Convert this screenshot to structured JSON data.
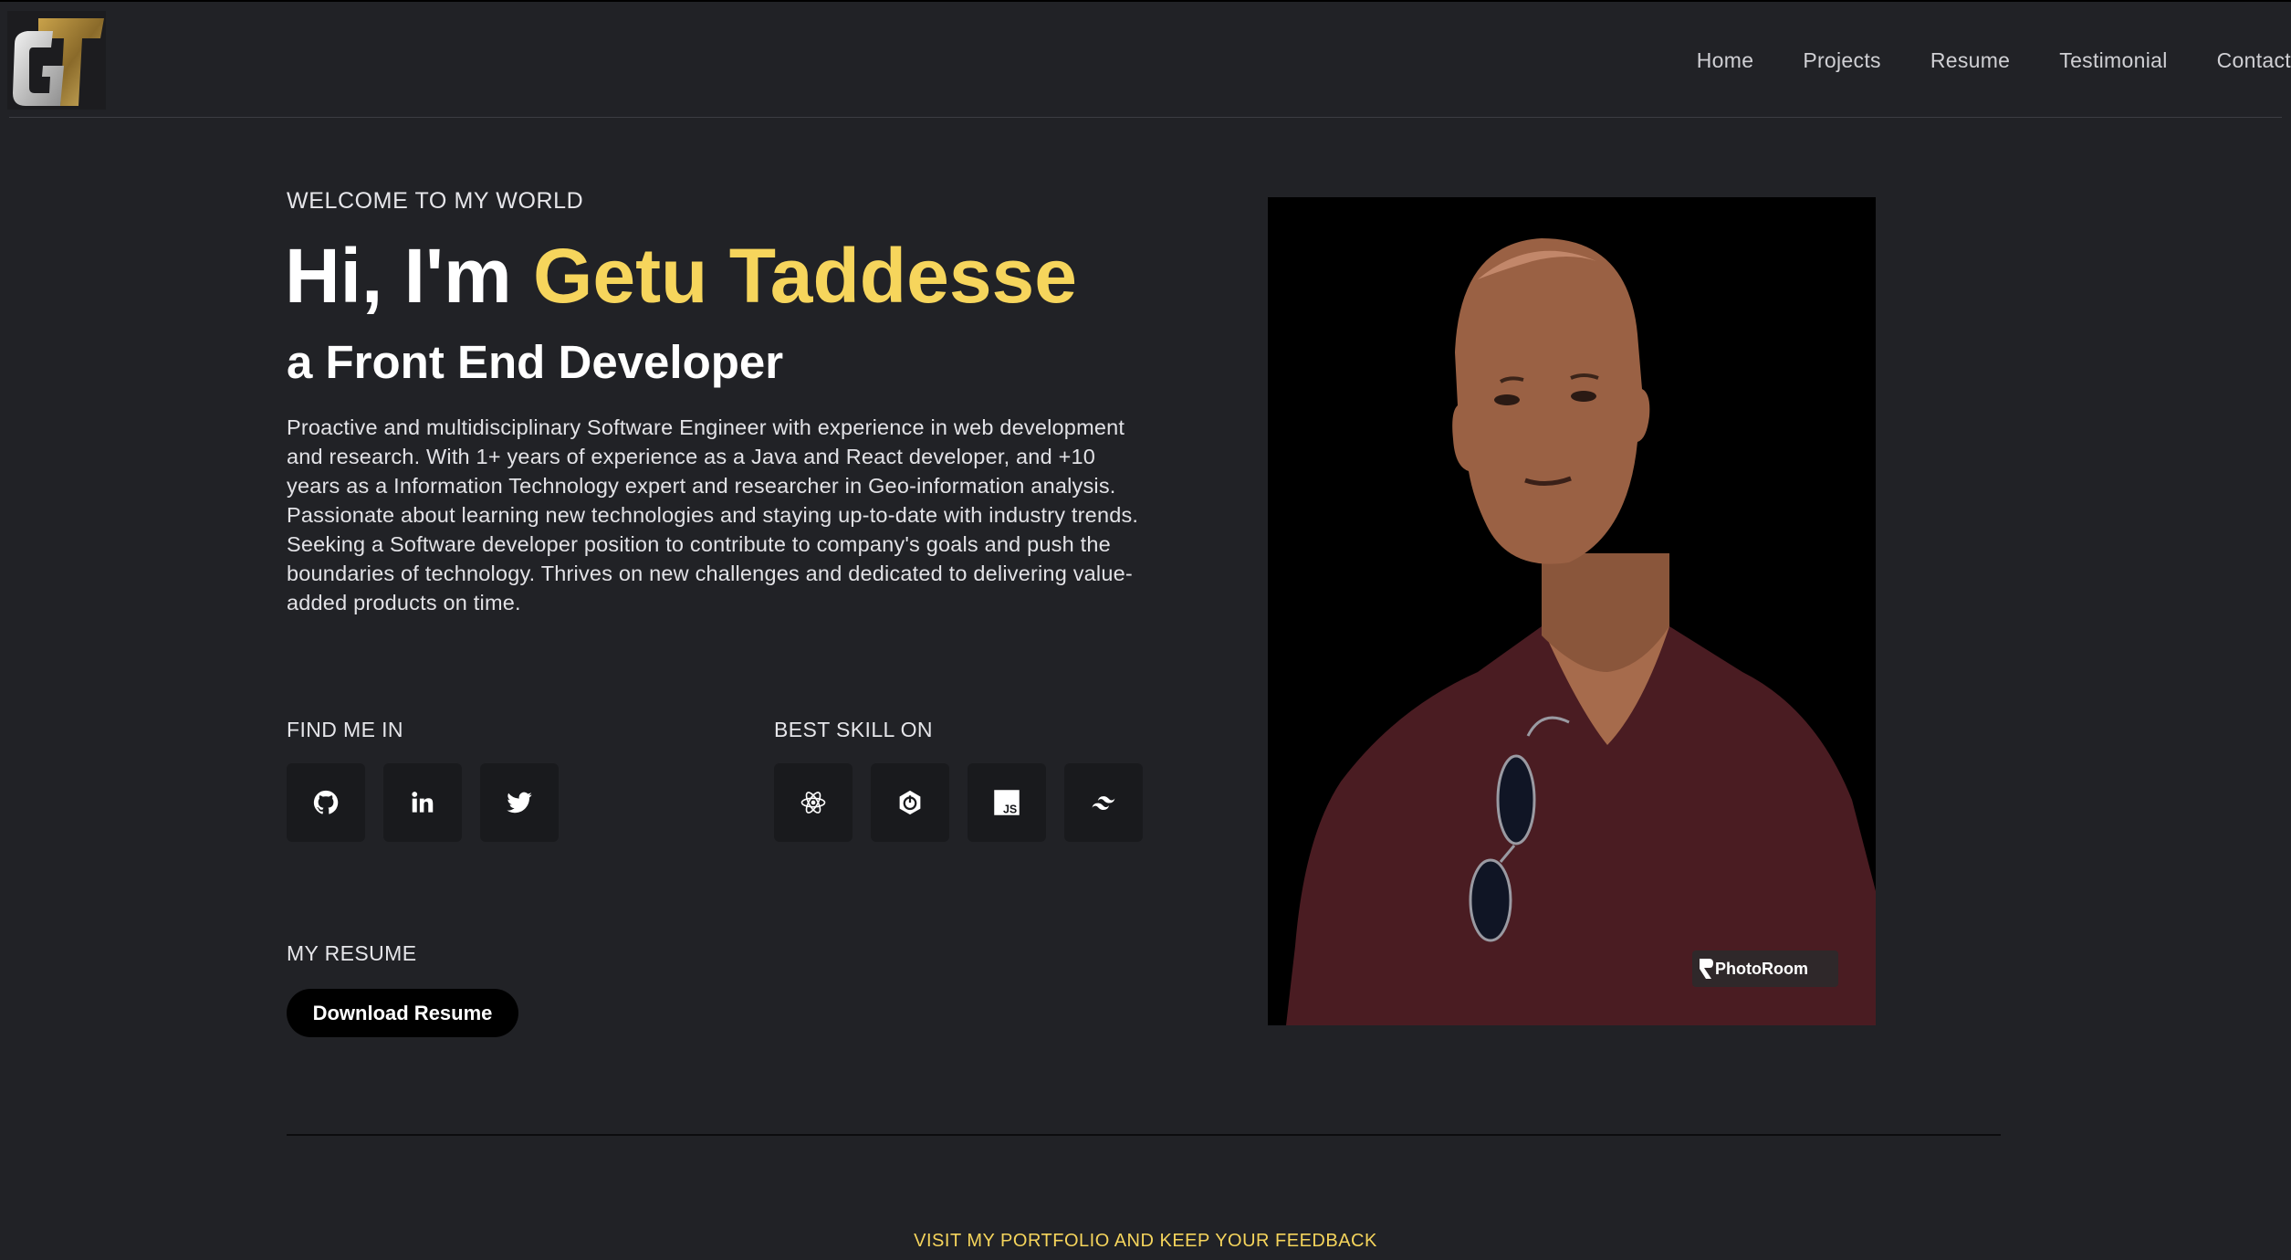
{
  "header": {
    "logo_text": "GT",
    "nav": [
      "Home",
      "Projects",
      "Resume",
      "Testimonial",
      "Contact"
    ]
  },
  "hero": {
    "welcome": "WELCOME TO MY WORLD",
    "greeting": "Hi, I'm ",
    "name": "Getu Taddesse",
    "role": "a Front End Developer",
    "bio": "Proactive and multidisciplinary Software Engineer with experience in web development and research. With 1+ years of experience as a Java and React developer, and +10 years as a Information Technology expert and researcher in Geo-information analysis. Passionate about learning new technologies and staying up-to-date with industry trends. Seeking a Software developer position to contribute to company's goals and push the boundaries of technology. Thrives on new challenges and dedicated to delivering value-added products on time."
  },
  "find_me": {
    "label": "FIND ME IN",
    "icons": [
      "github-icon",
      "linkedin-icon",
      "twitter-icon"
    ]
  },
  "skills": {
    "label": "BEST SKILL ON",
    "icons": [
      "react-icon",
      "spring-boot-icon",
      "javascript-icon",
      "tailwind-icon"
    ],
    "js_text": "JS"
  },
  "resume": {
    "label": "MY RESUME",
    "button": "Download Resume"
  },
  "portrait": {
    "watermark": "PhotoRoom"
  },
  "footer": {
    "note": "VISIT MY PORTFOLIO AND KEEP YOUR FEEDBACK"
  },
  "colors": {
    "background": "#212226",
    "accent": "#f6d55c",
    "icon_box": "#191a1d"
  }
}
